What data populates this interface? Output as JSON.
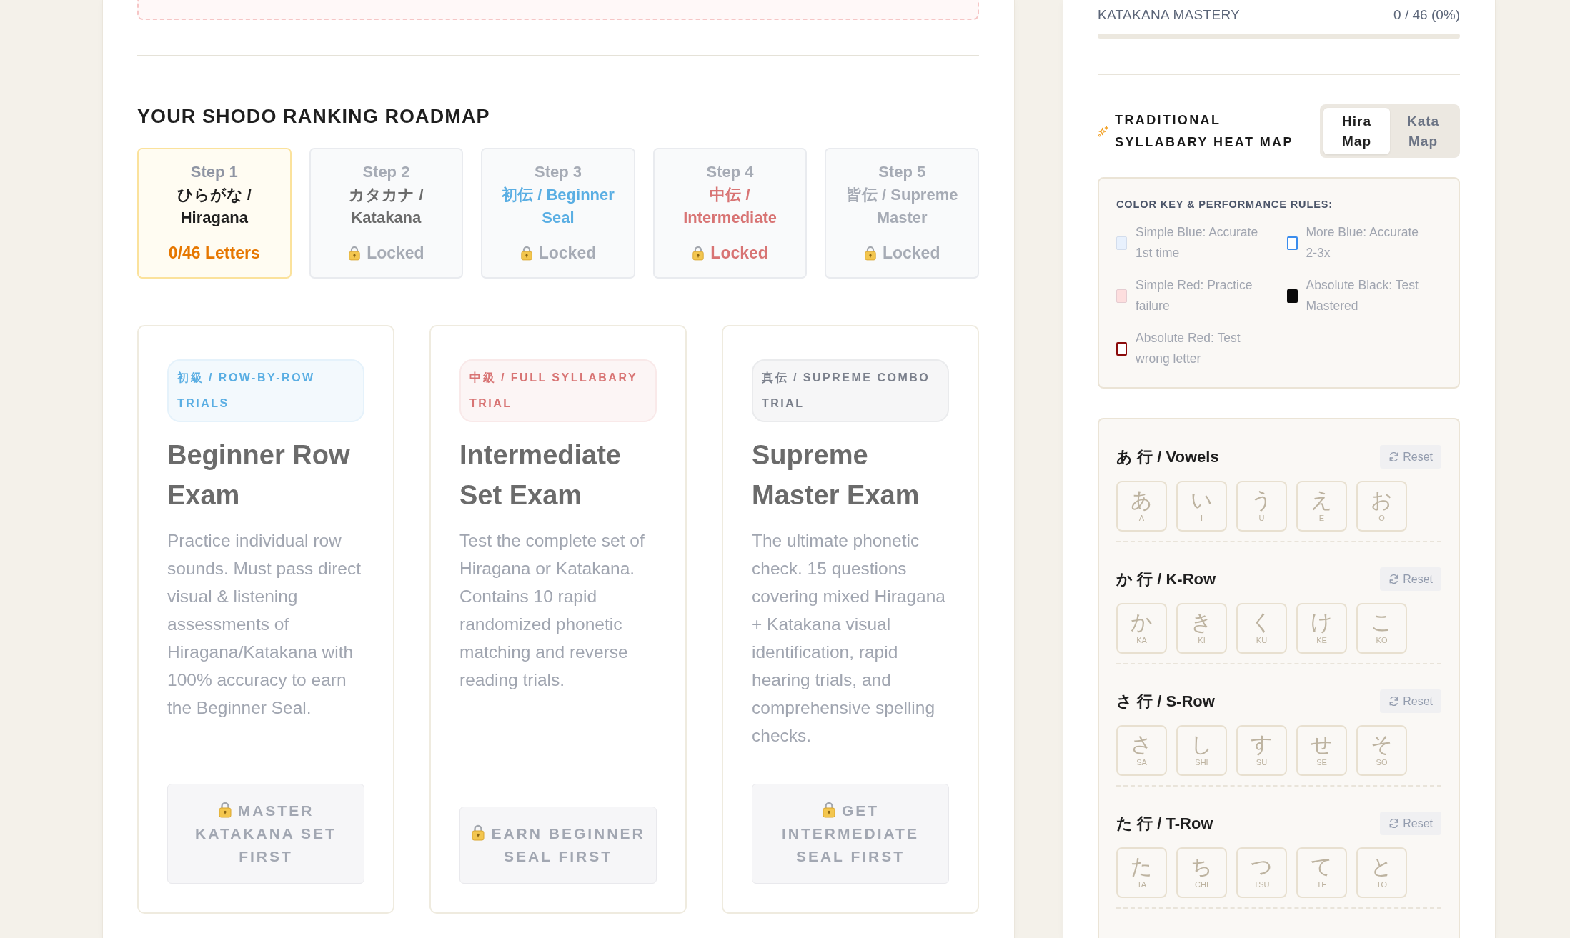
{
  "roadmap": {
    "title": "YOUR SHODO RANKING ROADMAP",
    "steps": [
      {
        "label": "Step 1",
        "title": "ひらがな / Hiragana",
        "status": {
          "text": "0/46 Letters",
          "color": "#e67700"
        },
        "current": true,
        "locked": false,
        "color": "#1f1f1f"
      },
      {
        "label": "Step 2",
        "title": "カタカナ / Katakana",
        "status": {
          "text": "Locked",
          "color": "#a6abb5"
        },
        "current": false,
        "locked": true,
        "color": "#6b6b6b"
      },
      {
        "label": "Step 3",
        "title": "初伝 / Beginner Seal",
        "status": {
          "text": "Locked",
          "color": "#a6abb5"
        },
        "current": false,
        "locked": true,
        "color": "#5aaee3"
      },
      {
        "label": "Step 4",
        "title": "中伝 / Intermediate",
        "status": {
          "text": "Locked",
          "color": "#d87474"
        },
        "current": false,
        "locked": true,
        "color": "#d87474"
      },
      {
        "label": "Step 5",
        "title": "皆伝 / Supreme Master",
        "status": {
          "text": "Locked",
          "color": "#a6abb5"
        },
        "current": false,
        "locked": true,
        "color": "#a6abb5"
      }
    ]
  },
  "exams": [
    {
      "tag": "初級 / ROW-BY-ROW TRIALS",
      "color": "#5aaee3",
      "title": "Beginner Row Exam",
      "description": "Practice individual row sounds. Must pass direct visual & listening assessments of Hiragana/Katakana with 100% accuracy to earn the Beginner Seal.",
      "button": "MASTER KATAKANA SET FIRST",
      "locked": true
    },
    {
      "tag": "中級 / FULL SYLLABARY TRIAL",
      "color": "#d87474",
      "title": "Intermediate Set Exam",
      "description": "Test the complete set of Hiragana or Katakana. Contains 10 rapid randomized phonetic matching and reverse reading trials.",
      "button": "EARN BEGINNER SEAL FIRST",
      "locked": true
    },
    {
      "tag": "真伝 / SUPREME COMBO TRIAL",
      "color": "#7b808c",
      "title": "Supreme Master Exam",
      "description": "The ultimate phonetic check. 15 questions covering mixed Hiragana + Katakana visual identification, rapid hearing trials, and comprehensive spelling checks.",
      "button": "GET INTERMEDIATE SEAL FIRST",
      "locked": true
    }
  ],
  "mastery": {
    "label": "KATAKANA MASTERY",
    "value": "0 / 46 (0%)",
    "level": 0
  },
  "heat_map": {
    "title": "TRADITIONAL SYLLABARY HEAT MAP",
    "tabs": [
      {
        "label": "Hira Map",
        "selected": true
      },
      {
        "label": "Kata Map",
        "selected": false
      }
    ],
    "legend": {
      "title": "COLOR KEY & PERFORMANCE RULES:",
      "items": [
        {
          "label": "Simple Blue: Accurate 1st time",
          "kind": "tint",
          "color": "#e8f1fd"
        },
        {
          "label": "More Blue: Accurate 2-3x",
          "kind": "outline",
          "color": "#3b8ded"
        },
        {
          "label": "Simple Red: Practice failure",
          "kind": "tint",
          "color": "#fddede"
        },
        {
          "label": "Absolute Black: Test Mastered",
          "kind": "solid",
          "color": "#0a0a0a"
        },
        {
          "label": "Absolute Red: Test wrong letter",
          "kind": "outline",
          "color": "#8b0b0b"
        }
      ]
    },
    "rows": [
      {
        "title": "あ 行 / Vowels",
        "reset": "Reset",
        "cells": [
          {
            "kana": "あ",
            "romaji": "A"
          },
          {
            "kana": "い",
            "romaji": "I"
          },
          {
            "kana": "う",
            "romaji": "U"
          },
          {
            "kana": "え",
            "romaji": "E"
          },
          {
            "kana": "お",
            "romaji": "O"
          }
        ]
      },
      {
        "title": "か 行 / K-Row",
        "reset": "Reset",
        "cells": [
          {
            "kana": "か",
            "romaji": "KA"
          },
          {
            "kana": "き",
            "romaji": "KI"
          },
          {
            "kana": "く",
            "romaji": "KU"
          },
          {
            "kana": "け",
            "romaji": "KE"
          },
          {
            "kana": "こ",
            "romaji": "KO"
          }
        ]
      },
      {
        "title": "さ 行 / S-Row",
        "reset": "Reset",
        "cells": [
          {
            "kana": "さ",
            "romaji": "SA"
          },
          {
            "kana": "し",
            "romaji": "SHI"
          },
          {
            "kana": "す",
            "romaji": "SU"
          },
          {
            "kana": "せ",
            "romaji": "SE"
          },
          {
            "kana": "そ",
            "romaji": "SO"
          }
        ]
      },
      {
        "title": "た 行 / T-Row",
        "reset": "Reset",
        "cells": [
          {
            "kana": "た",
            "romaji": "TA"
          },
          {
            "kana": "ち",
            "romaji": "CHI"
          },
          {
            "kana": "つ",
            "romaji": "TSU"
          },
          {
            "kana": "て",
            "romaji": "TE"
          },
          {
            "kana": "と",
            "romaji": "TO"
          }
        ]
      }
    ]
  }
}
